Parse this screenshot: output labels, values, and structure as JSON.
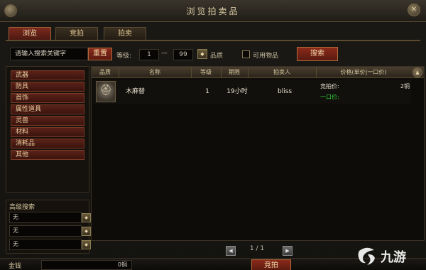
{
  "window": {
    "title": "浏览拍卖品"
  },
  "tabs": [
    {
      "label": "浏览",
      "active": true
    },
    {
      "label": "竞拍",
      "active": false
    },
    {
      "label": "拍卖",
      "active": false
    }
  ],
  "search": {
    "placeholder": "请输入搜索关键字",
    "reset_label": "重置",
    "level_label": "等级:",
    "level_min": "1",
    "level_separator": "—",
    "level_max": "99",
    "quality_label": "品质",
    "usable_label": "可用物品",
    "usable_checked": false,
    "search_label": "搜索"
  },
  "categories": [
    "武器",
    "防具",
    "首饰",
    "属性道具",
    "灵兽",
    "材料",
    "消耗品",
    "其他"
  ],
  "advanced": {
    "title": "高级搜索",
    "rows": [
      "无",
      "无",
      "无"
    ]
  },
  "table": {
    "columns": [
      "品质",
      "名称",
      "等级",
      "期限",
      "拍卖人",
      "价格(单价|一口价)"
    ],
    "rows": [
      {
        "icon": "helmet-icon",
        "name": "木麻替",
        "level": "1",
        "duration": "19小时",
        "seller": "bliss",
        "bid_label": "竞拍价:",
        "bid_value": "2铜",
        "buyout_label": "一口价:"
      }
    ]
  },
  "pagination": {
    "text": "1 / 1"
  },
  "footer": {
    "gold_label": "金钱",
    "gold_value": "0铜",
    "bid_button": "竞拍"
  },
  "watermark": {
    "text": "九游"
  },
  "colors": {
    "accent_red": "#7a2a1c",
    "gold_text": "#e0c890",
    "buyout_green": "#2fd03a"
  }
}
